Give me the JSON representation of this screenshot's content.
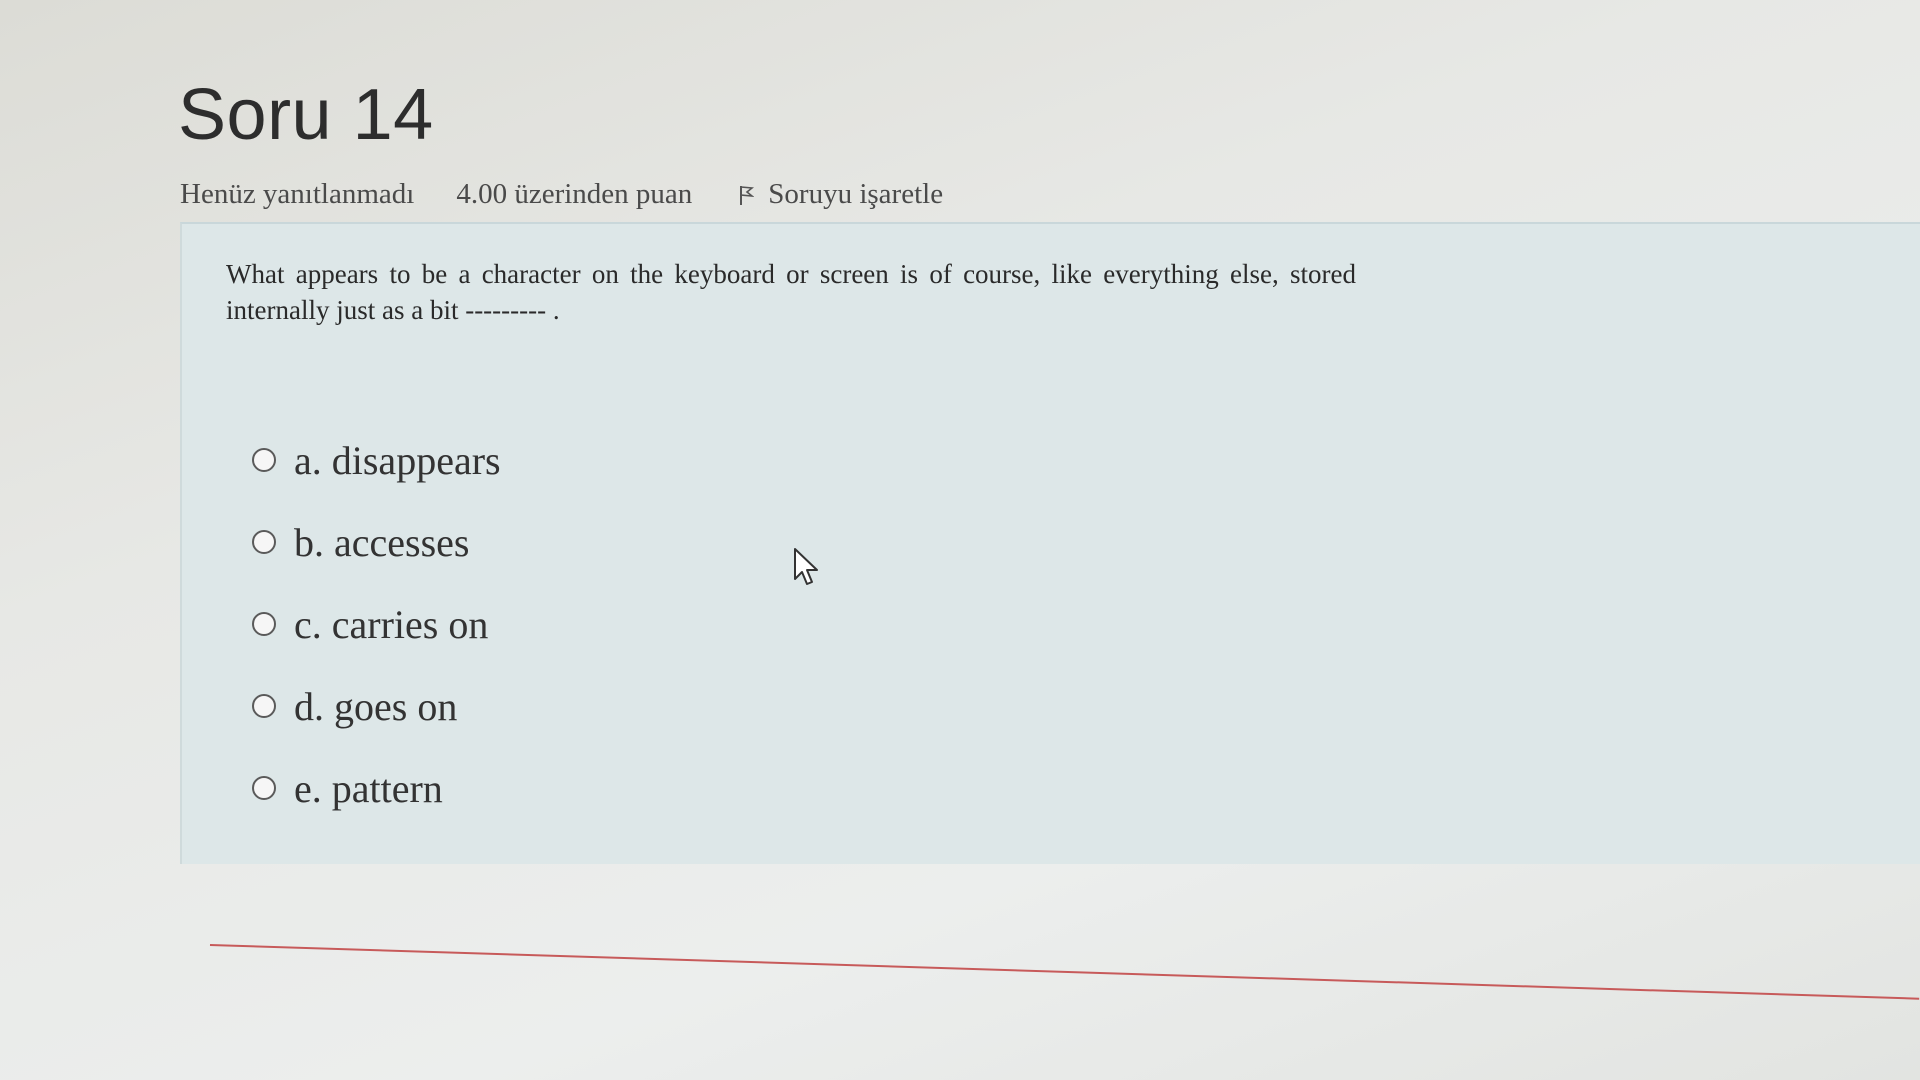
{
  "question": {
    "title": "Soru 14",
    "status": "Henüz yanıtlanmadı",
    "points": "4.00 üzerinden puan",
    "flag_label": "Soruyu işaretle",
    "text": "What appears to be a character on the keyboard or screen is of course, like everything else, stored internally just as a bit --------- .",
    "options": [
      {
        "label": "a. disappears"
      },
      {
        "label": "b. accesses"
      },
      {
        "label": "c. carries on"
      },
      {
        "label": "d. goes on"
      },
      {
        "label": "e. pattern"
      }
    ]
  },
  "colors": {
    "question_box": "#dde7e8",
    "divider_line": "#c75a5a"
  },
  "icons": {
    "flag": "flag-icon",
    "cursor": "mouse-pointer-icon"
  }
}
